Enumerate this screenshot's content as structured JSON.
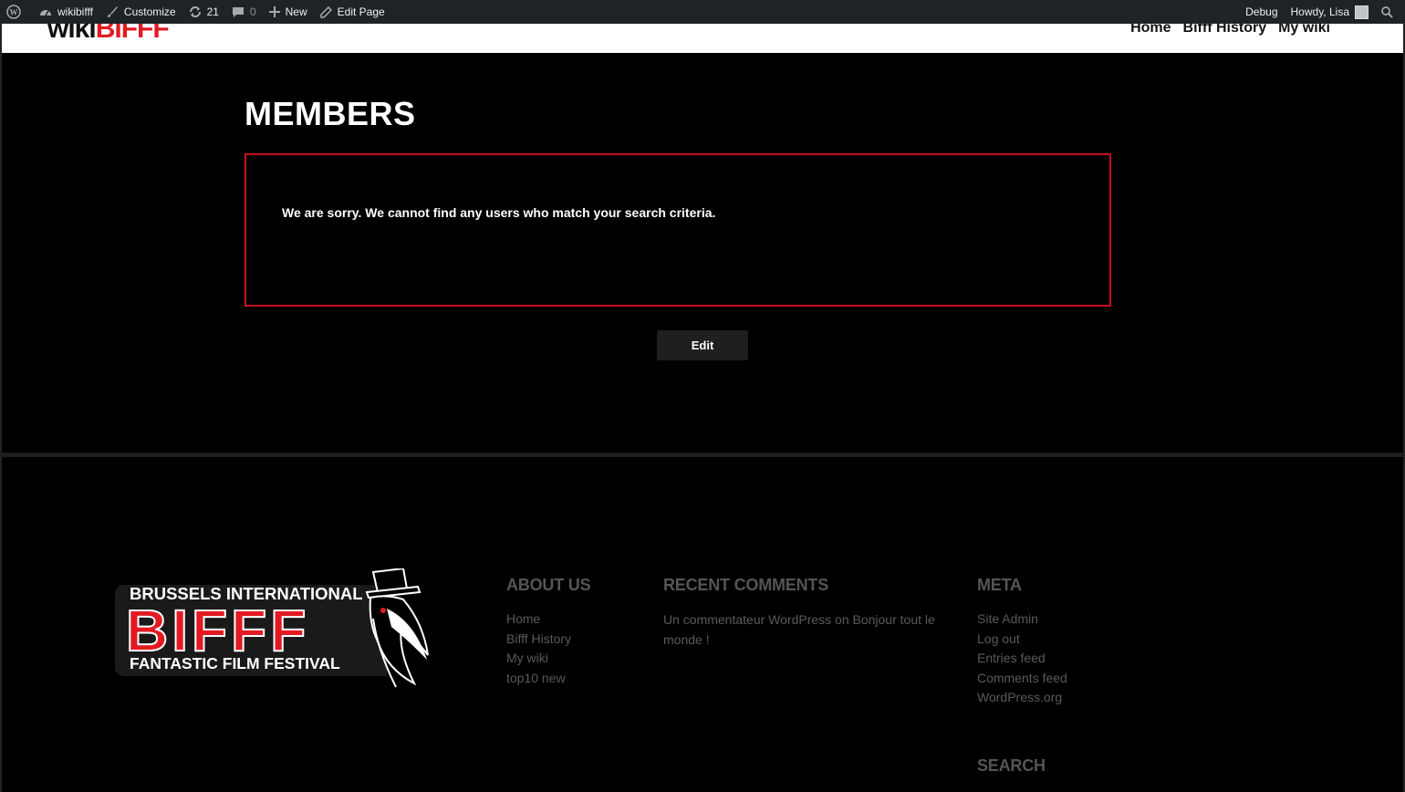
{
  "adminbar": {
    "site_name": "wikibifff",
    "customize": "Customize",
    "updates_count": "21",
    "comments_count": "0",
    "new_label": "New",
    "edit_page": "Edit Page",
    "debug": "Debug",
    "howdy": "Howdy, Lisa"
  },
  "header": {
    "logo_part1": "wiki",
    "logo_part2": "BIFFF",
    "nav": [
      "Home",
      "Bifff History",
      "My wiki"
    ]
  },
  "main": {
    "title": "MEMBERS",
    "notice": "We are sorry. We cannot find any users who match your search criteria.",
    "edit_label": "Edit"
  },
  "footer": {
    "logo": {
      "line1": "BRUSSELS INTERNATIONAL",
      "line2": "BIFFF",
      "line3": "FANTASTIC FILM FESTIVAL"
    },
    "about": {
      "heading": "ABOUT US",
      "items": [
        "Home",
        "Bifff History",
        "My wiki",
        "top10 new"
      ]
    },
    "comments": {
      "heading": "RECENT COMMENTS",
      "author": "Un commentateur WordPress",
      "on": "on",
      "post": "Bonjour tout le monde !"
    },
    "meta": {
      "heading": "META",
      "items": [
        "Site Admin",
        "Log out",
        "Entries feed",
        "Comments feed",
        "WordPress.org"
      ]
    },
    "search": {
      "heading": "SEARCH"
    }
  },
  "colors": {
    "accent": "#c4121e",
    "adminbar": "#1d2327",
    "background": "#000000"
  }
}
